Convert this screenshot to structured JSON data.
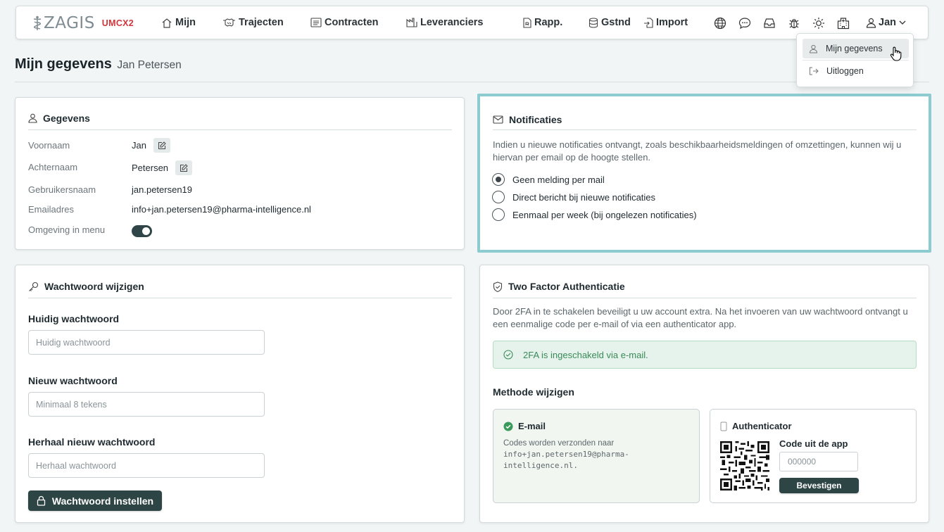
{
  "brand": {
    "name": "ZAGIS",
    "environment": "UMCX2"
  },
  "nav": [
    {
      "label": "Mijn"
    },
    {
      "label": "Trajecten"
    },
    {
      "label": "Contracten"
    },
    {
      "label": "Leveranciers"
    },
    {
      "label": "Rapp."
    },
    {
      "label": "Gstnd"
    },
    {
      "label": "Import"
    }
  ],
  "nav_icons": [
    "globe-icon",
    "chat-icon",
    "inbox-icon",
    "bug-icon",
    "sun-icon",
    "hospital-icon"
  ],
  "user": {
    "name": "Jan"
  },
  "dropdown": {
    "items": [
      {
        "label": "Mijn gegevens"
      },
      {
        "label": "Uitloggen"
      }
    ]
  },
  "page": {
    "title": "Mijn gegevens",
    "subtitle": "Jan Petersen"
  },
  "gegevens": {
    "title": "Gegevens",
    "rows": [
      {
        "label": "Voornaam",
        "value": "Jan"
      },
      {
        "label": "Achternaam",
        "value": "Petersen"
      },
      {
        "label": "Gebruikersnaam",
        "value": "jan.petersen19"
      },
      {
        "label": "Emailadres",
        "value": "info+jan.petersen19@pharma-intelligence.nl"
      },
      {
        "label": "Omgeving in menu",
        "value": ""
      }
    ],
    "omgeving_enabled": true
  },
  "notificaties": {
    "title": "Notificaties",
    "description": "Indien u nieuwe notificaties ontvangt, zoals beschikbaarheidsmeldingen of omzettingen, kunnen wij u hiervan per email op de hoogte stellen.",
    "options": [
      {
        "label": "Geen melding per mail",
        "checked": true
      },
      {
        "label": "Direct bericht bij nieuwe notificaties",
        "checked": false
      },
      {
        "label": "Eenmaal per week (bij ongelezen notificaties)",
        "checked": false
      }
    ]
  },
  "wachtwoord": {
    "title": "Wachtwoord wijzigen",
    "fields": [
      {
        "label": "Huidig wachtwoord",
        "placeholder": "Huidig wachtwoord",
        "value": ""
      },
      {
        "label": "Nieuw wachtwoord",
        "placeholder": "Minimaal 8 tekens",
        "value": ""
      },
      {
        "label": "Herhaal nieuw wachtwoord",
        "placeholder": "Herhaal wachtwoord",
        "value": ""
      }
    ],
    "submit_label": "Wachtwoord instellen"
  },
  "twofa": {
    "title": "Two Factor Authenticatie",
    "description": "Door 2FA in te schakelen beveiligt u uw account extra. Na het invoeren van uw wachtwoord ontvangt u een eenmalige code per e-mail of via een authenticator app.",
    "status": "2FA is ingeschakeld via e-mail.",
    "methods_title": "Methode wijzigen",
    "email_method": {
      "title": "E-mail",
      "text": "Codes worden verzonden naar",
      "address": "info+jan.petersen19@pharma-intelligence.nl."
    },
    "auth_method": {
      "title": "Authenticator",
      "code_label": "Code uit de app",
      "code_placeholder": "000000",
      "confirm_label": "Bevestigen"
    }
  },
  "colors": {
    "accent": "#2e4546",
    "brand_env": "#d2353b",
    "highlight_border": "#8ccbd0",
    "success": "#3a8a58"
  }
}
